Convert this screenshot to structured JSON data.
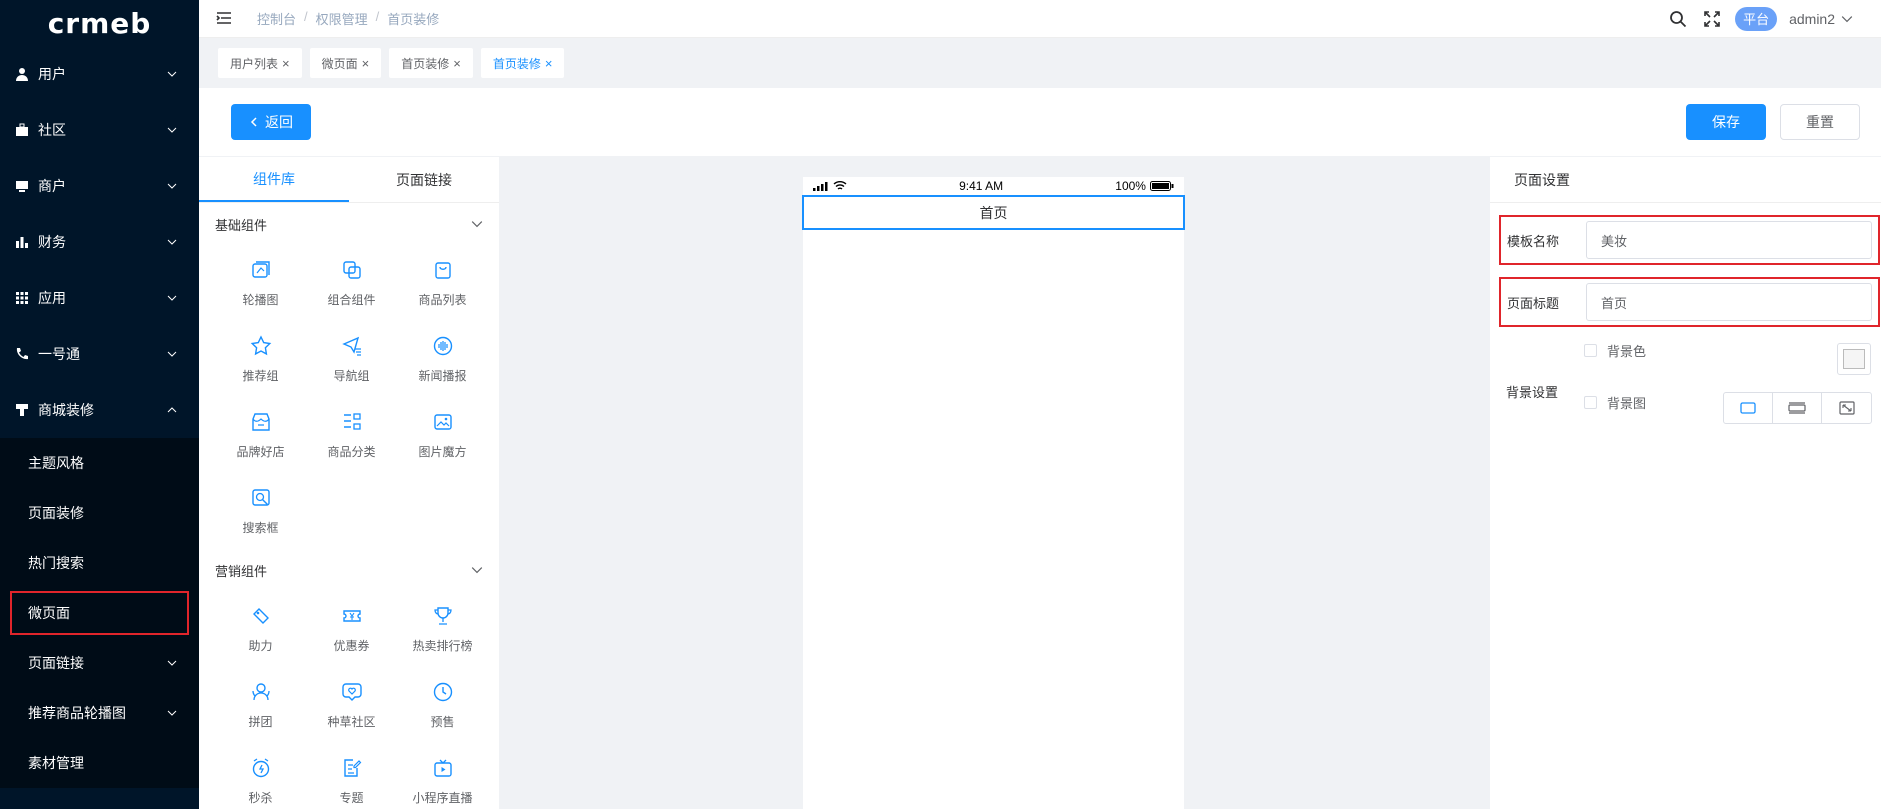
{
  "logo": "crmeb",
  "sidebar": {
    "items": [
      {
        "label": "用户",
        "icon": "user-icon"
      },
      {
        "label": "社区",
        "icon": "briefcase-icon"
      },
      {
        "label": "商户",
        "icon": "monitor-icon"
      },
      {
        "label": "财务",
        "icon": "bar-chart-icon"
      },
      {
        "label": "应用",
        "icon": "grid-icon"
      },
      {
        "label": "一号通",
        "icon": "phone-icon"
      },
      {
        "label": "商城装修",
        "icon": "brush-icon"
      }
    ],
    "sub_items": [
      {
        "label": "主题风格"
      },
      {
        "label": "页面装修"
      },
      {
        "label": "热门搜索"
      },
      {
        "label": "微页面"
      },
      {
        "label": "页面链接"
      },
      {
        "label": "推荐商品轮播图"
      },
      {
        "label": "素材管理"
      }
    ]
  },
  "header": {
    "breadcrumb": [
      "控制台",
      "权限管理",
      "首页装修"
    ],
    "platform": "平台",
    "user": "admin2"
  },
  "tags": [
    {
      "label": "用户列表"
    },
    {
      "label": "微页面"
    },
    {
      "label": "首页装修"
    },
    {
      "label": "首页装修"
    }
  ],
  "actions": {
    "back": "返回",
    "save": "保存",
    "reset": "重置"
  },
  "components": {
    "tabs": [
      "组件库",
      "页面链接"
    ],
    "basic": {
      "title": "基础组件",
      "items": [
        {
          "label": "轮播图",
          "icon": "carousel-icon"
        },
        {
          "label": "组合组件",
          "icon": "combine-icon"
        },
        {
          "label": "商品列表",
          "icon": "bag-icon"
        },
        {
          "label": "推荐组",
          "icon": "star-icon"
        },
        {
          "label": "导航组",
          "icon": "navigation-icon"
        },
        {
          "label": "新闻播报",
          "icon": "broadcast-icon"
        },
        {
          "label": "品牌好店",
          "icon": "store-icon"
        },
        {
          "label": "商品分类",
          "icon": "category-icon"
        },
        {
          "label": "图片魔方",
          "icon": "image-icon"
        },
        {
          "label": "搜索框",
          "icon": "search-box-icon"
        }
      ]
    },
    "marketing": {
      "title": "营销组件",
      "items": [
        {
          "label": "助力",
          "icon": "assist-icon"
        },
        {
          "label": "优惠券",
          "icon": "coupon-icon"
        },
        {
          "label": "热卖排行榜",
          "icon": "trophy-icon"
        },
        {
          "label": "拼团",
          "icon": "group-icon"
        },
        {
          "label": "种草社区",
          "icon": "heart-chat-icon"
        },
        {
          "label": "预售",
          "icon": "clock-icon"
        },
        {
          "label": "秒杀",
          "icon": "alarm-icon"
        },
        {
          "label": "专题",
          "icon": "edit-doc-icon"
        },
        {
          "label": "小程序直播",
          "icon": "live-icon"
        }
      ]
    }
  },
  "phone": {
    "time": "9:41 AM",
    "battery": "100%",
    "title": "首页"
  },
  "settings": {
    "title": "页面设置",
    "template_name_label": "模板名称",
    "template_name_value": "美妆",
    "page_title_label": "页面标题",
    "page_title_value": "首页",
    "bg_settings_label": "背景设置",
    "bg_color_label": "背景色",
    "bg_image_label": "背景图"
  },
  "colors": {
    "sidebar": "#001529",
    "primary": "#1890ff",
    "highlight": "#e0252b"
  }
}
